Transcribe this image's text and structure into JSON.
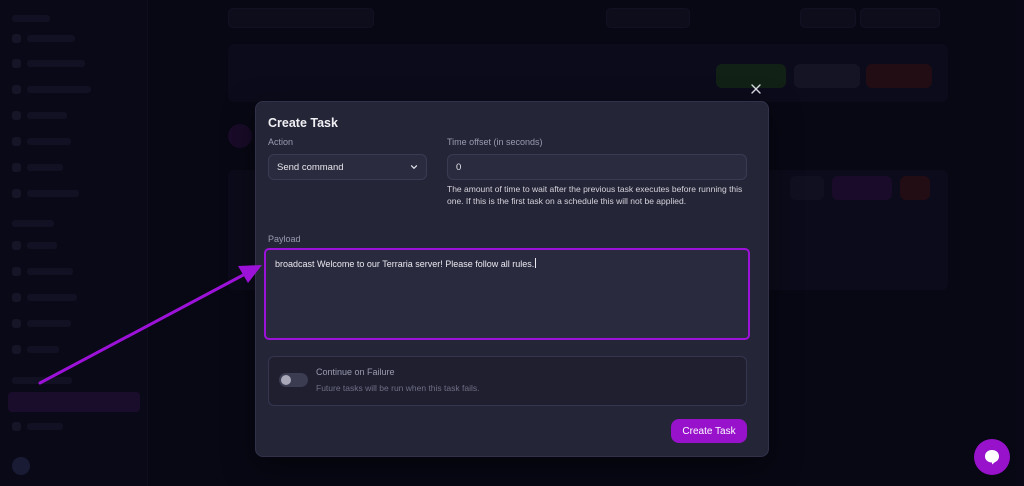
{
  "modal": {
    "title": "Create Task",
    "close_icon": "close-icon",
    "action": {
      "label": "Action",
      "value": "Send command"
    },
    "time_offset": {
      "label": "Time offset (in seconds)",
      "value": "0",
      "hint": "The amount of time to wait after the previous task executes before running this one. If this is the first task on a schedule this will not be applied."
    },
    "payload": {
      "label": "Payload",
      "value": "broadcast Welcome to our Terraria server! Please follow all rules."
    },
    "continue_on_failure": {
      "title": "Continue on Failure",
      "description": "Future tasks will be run when this task fails.",
      "enabled": false
    },
    "create_button": "Create Task"
  },
  "annotation": {
    "highlight_color": "#9c12d8"
  },
  "chat_widget": {
    "icon": "chat-bubble-icon",
    "color": "#9812cc"
  }
}
